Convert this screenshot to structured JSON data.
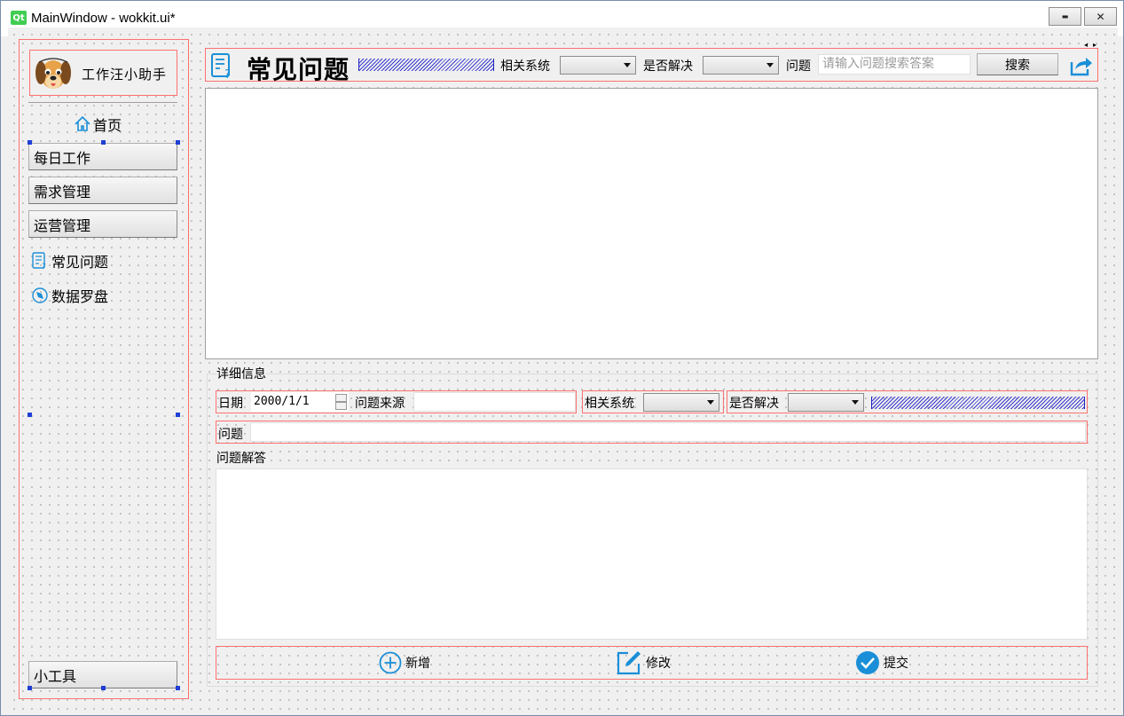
{
  "window": {
    "qt_badge": "Qt",
    "title": "MainWindow - wokkit.ui*",
    "minimize_symbol": "▬",
    "close_symbol": "✕"
  },
  "sidebar": {
    "app_name": "工作汪小助手",
    "home_label": "首页",
    "buttons": [
      "每日工作",
      "需求管理",
      "运营管理"
    ],
    "links": [
      {
        "label": "常见问题",
        "icon": "faq-doc-icon"
      },
      {
        "label": "数据罗盘",
        "icon": "compass-icon"
      }
    ],
    "tools_label": "小工具"
  },
  "header": {
    "title": "常见问题",
    "system_label": "相关系统",
    "solved_label": "是否解决",
    "question_label": "问题",
    "search_placeholder": "请输入问题搜索答案",
    "search_button": "搜索"
  },
  "detail": {
    "group_title": "详细信息",
    "date_label": "日期",
    "date_value": "2000/1/1",
    "source_label": "问题来源",
    "system_label": "相关系统",
    "solved_label": "是否解决",
    "question_label": "问题",
    "answer_label": "问题解答"
  },
  "actions": {
    "add": "新增",
    "edit": "修改",
    "submit": "提交"
  },
  "colors": {
    "accent_blue": "#1a8fd8",
    "designer_red": "#ff7070",
    "handle_blue": "#1f3fd6"
  }
}
